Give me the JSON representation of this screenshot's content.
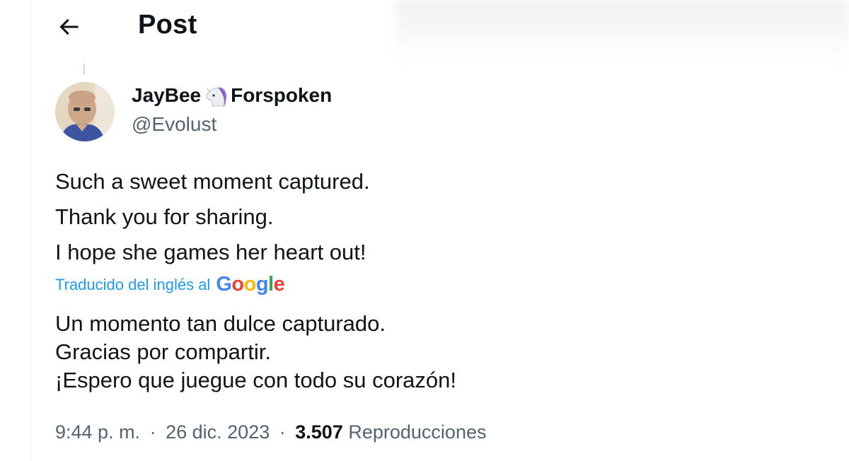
{
  "header": {
    "back_icon": "arrow-left-icon",
    "title": "Post"
  },
  "post": {
    "author": {
      "name_part1": "JayBee",
      "emoji_icon": "unicorn-icon",
      "name_part2": "Forspoken",
      "handle": "@Evolust"
    },
    "text_lines": [
      "Such a sweet moment captured.",
      "Thank you for sharing.",
      "I hope she games her heart out!"
    ],
    "translation": {
      "label": "Traducido del inglés al",
      "provider": "Google",
      "provider_colors": [
        "#4285F4",
        "#EA4335",
        "#FBBC05",
        "#4285F4",
        "#34A853",
        "#EA4335"
      ],
      "lines": [
        "Un momento tan dulce capturado.",
        "Gracias por compartir.",
        "¡Espero que juegue con todo su corazón!"
      ]
    },
    "meta": {
      "time": "9:44 p. m.",
      "separator": "·",
      "date": "26 dic. 2023",
      "views_count": "3.507",
      "views_label": "Reproducciones"
    }
  },
  "colors": {
    "text_primary": "#0f1419",
    "text_secondary": "#536471",
    "link_blue": "#1d9bf0",
    "border": "#eff3f4"
  }
}
